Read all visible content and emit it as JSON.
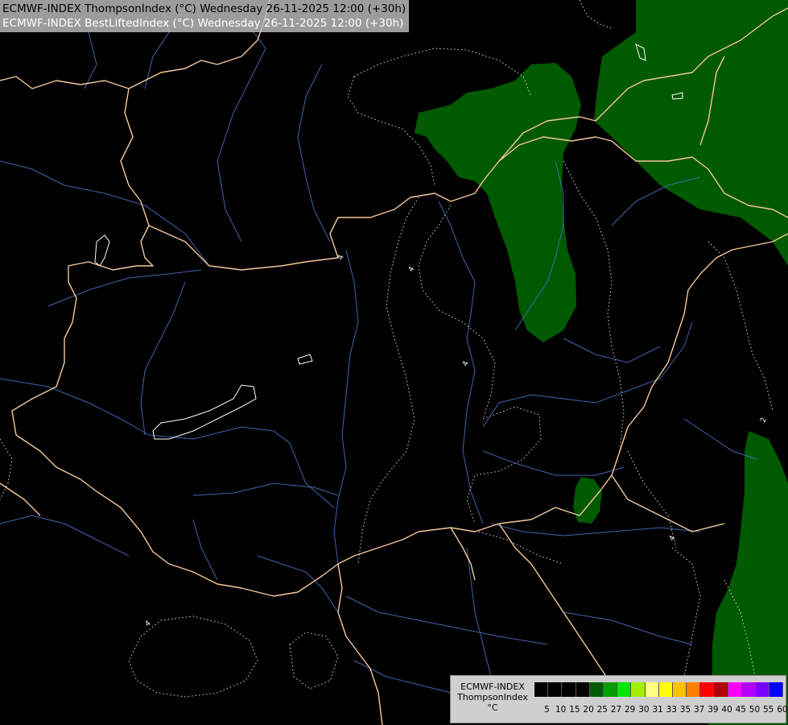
{
  "header": {
    "line1": "ECMWF-INDEX ThompsonIndex (°C) Wednesday 26-11-2025 12:00 (+30h)",
    "line2": "ECMWF-INDEX BestLiftedIndex (°C) Wednesday 26-11-2025 12:00 (+30h)"
  },
  "legend": {
    "model": "ECMWF-INDEX",
    "parameter": "ThompsonIndex",
    "unit": "°C",
    "ticks": [
      "5",
      "10",
      "15",
      "20",
      "25",
      "27",
      "29",
      "30",
      "31",
      "33",
      "35",
      "37",
      "39",
      "40",
      "45",
      "50",
      "55",
      "60"
    ],
    "colors": [
      "#000000",
      "#000000",
      "#000000",
      "#000000",
      "#005a00",
      "#00a000",
      "#00e600",
      "#a0f000",
      "#ffff80",
      "#ffff00",
      "#ffc000",
      "#ff8000",
      "#ff0000",
      "#b00000",
      "#ff00ff",
      "#b400ff",
      "#7800ff",
      "#0000ff"
    ]
  },
  "contour_labels": [
    "4",
    "4",
    "4",
    "4",
    "2",
    "4"
  ],
  "colors": {
    "background": "#000000",
    "border": "#f5c89a",
    "river": "#4a6fc0",
    "fill_25": "#005a00",
    "contour": "#ffffff"
  }
}
